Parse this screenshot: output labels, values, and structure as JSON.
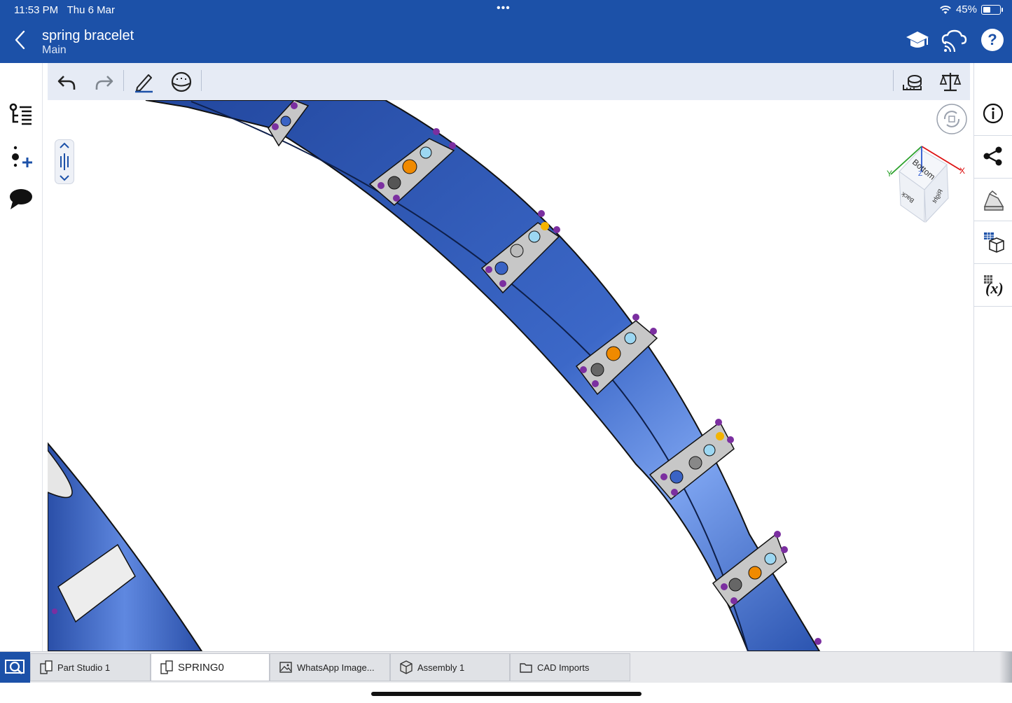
{
  "status_bar": {
    "time": "11:53 PM",
    "date": "Thu 6 Mar",
    "battery": "45%",
    "battery_level": 0.45,
    "multitask_dots": "•••"
  },
  "app_bar": {
    "title": "spring bracelet",
    "subtitle": "Main",
    "icons": [
      "learning-center-icon",
      "cloud-connect-icon",
      "help-icon"
    ]
  },
  "left_rail": {
    "icons": [
      "feature-list-icon",
      "add-variable-icon",
      "comments-icon"
    ]
  },
  "toolbar": {
    "icons": [
      "undo-icon",
      "redo-icon",
      "sketch-icon",
      "view-style-icon",
      "measure-icon",
      "mass-properties-icon"
    ]
  },
  "view_cube": {
    "faces": {
      "top": "Bottom",
      "left": "Back",
      "right": "Right"
    },
    "axes": {
      "x": "X",
      "y": "Y",
      "z": "Z"
    }
  },
  "right_rail": {
    "icons": [
      "info-icon",
      "share-icon",
      "appearance-icon",
      "configuration-icon",
      "variables-icon"
    ]
  },
  "tabs": [
    {
      "label": "Part Studio 1",
      "icon": "part-studio-icon"
    },
    {
      "label": "SPRING0",
      "icon": "part-studio-icon",
      "active": true
    },
    {
      "label": "WhatsApp Image...",
      "icon": "image-icon"
    },
    {
      "label": "Assembly 1",
      "icon": "assembly-icon"
    },
    {
      "label": "CAD Imports",
      "icon": "folder-icon"
    }
  ]
}
